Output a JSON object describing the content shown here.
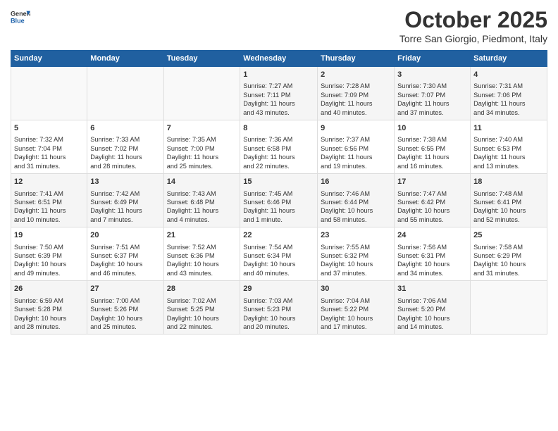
{
  "header": {
    "logo_general": "General",
    "logo_blue": "Blue",
    "title": "October 2025",
    "location": "Torre San Giorgio, Piedmont, Italy"
  },
  "days_of_week": [
    "Sunday",
    "Monday",
    "Tuesday",
    "Wednesday",
    "Thursday",
    "Friday",
    "Saturday"
  ],
  "weeks": [
    [
      {
        "day": "",
        "info": ""
      },
      {
        "day": "",
        "info": ""
      },
      {
        "day": "",
        "info": ""
      },
      {
        "day": "1",
        "info": "Sunrise: 7:27 AM\nSunset: 7:11 PM\nDaylight: 11 hours\nand 43 minutes."
      },
      {
        "day": "2",
        "info": "Sunrise: 7:28 AM\nSunset: 7:09 PM\nDaylight: 11 hours\nand 40 minutes."
      },
      {
        "day": "3",
        "info": "Sunrise: 7:30 AM\nSunset: 7:07 PM\nDaylight: 11 hours\nand 37 minutes."
      },
      {
        "day": "4",
        "info": "Sunrise: 7:31 AM\nSunset: 7:06 PM\nDaylight: 11 hours\nand 34 minutes."
      }
    ],
    [
      {
        "day": "5",
        "info": "Sunrise: 7:32 AM\nSunset: 7:04 PM\nDaylight: 11 hours\nand 31 minutes."
      },
      {
        "day": "6",
        "info": "Sunrise: 7:33 AM\nSunset: 7:02 PM\nDaylight: 11 hours\nand 28 minutes."
      },
      {
        "day": "7",
        "info": "Sunrise: 7:35 AM\nSunset: 7:00 PM\nDaylight: 11 hours\nand 25 minutes."
      },
      {
        "day": "8",
        "info": "Sunrise: 7:36 AM\nSunset: 6:58 PM\nDaylight: 11 hours\nand 22 minutes."
      },
      {
        "day": "9",
        "info": "Sunrise: 7:37 AM\nSunset: 6:56 PM\nDaylight: 11 hours\nand 19 minutes."
      },
      {
        "day": "10",
        "info": "Sunrise: 7:38 AM\nSunset: 6:55 PM\nDaylight: 11 hours\nand 16 minutes."
      },
      {
        "day": "11",
        "info": "Sunrise: 7:40 AM\nSunset: 6:53 PM\nDaylight: 11 hours\nand 13 minutes."
      }
    ],
    [
      {
        "day": "12",
        "info": "Sunrise: 7:41 AM\nSunset: 6:51 PM\nDaylight: 11 hours\nand 10 minutes."
      },
      {
        "day": "13",
        "info": "Sunrise: 7:42 AM\nSunset: 6:49 PM\nDaylight: 11 hours\nand 7 minutes."
      },
      {
        "day": "14",
        "info": "Sunrise: 7:43 AM\nSunset: 6:48 PM\nDaylight: 11 hours\nand 4 minutes."
      },
      {
        "day": "15",
        "info": "Sunrise: 7:45 AM\nSunset: 6:46 PM\nDaylight: 11 hours\nand 1 minute."
      },
      {
        "day": "16",
        "info": "Sunrise: 7:46 AM\nSunset: 6:44 PM\nDaylight: 10 hours\nand 58 minutes."
      },
      {
        "day": "17",
        "info": "Sunrise: 7:47 AM\nSunset: 6:42 PM\nDaylight: 10 hours\nand 55 minutes."
      },
      {
        "day": "18",
        "info": "Sunrise: 7:48 AM\nSunset: 6:41 PM\nDaylight: 10 hours\nand 52 minutes."
      }
    ],
    [
      {
        "day": "19",
        "info": "Sunrise: 7:50 AM\nSunset: 6:39 PM\nDaylight: 10 hours\nand 49 minutes."
      },
      {
        "day": "20",
        "info": "Sunrise: 7:51 AM\nSunset: 6:37 PM\nDaylight: 10 hours\nand 46 minutes."
      },
      {
        "day": "21",
        "info": "Sunrise: 7:52 AM\nSunset: 6:36 PM\nDaylight: 10 hours\nand 43 minutes."
      },
      {
        "day": "22",
        "info": "Sunrise: 7:54 AM\nSunset: 6:34 PM\nDaylight: 10 hours\nand 40 minutes."
      },
      {
        "day": "23",
        "info": "Sunrise: 7:55 AM\nSunset: 6:32 PM\nDaylight: 10 hours\nand 37 minutes."
      },
      {
        "day": "24",
        "info": "Sunrise: 7:56 AM\nSunset: 6:31 PM\nDaylight: 10 hours\nand 34 minutes."
      },
      {
        "day": "25",
        "info": "Sunrise: 7:58 AM\nSunset: 6:29 PM\nDaylight: 10 hours\nand 31 minutes."
      }
    ],
    [
      {
        "day": "26",
        "info": "Sunrise: 6:59 AM\nSunset: 5:28 PM\nDaylight: 10 hours\nand 28 minutes."
      },
      {
        "day": "27",
        "info": "Sunrise: 7:00 AM\nSunset: 5:26 PM\nDaylight: 10 hours\nand 25 minutes."
      },
      {
        "day": "28",
        "info": "Sunrise: 7:02 AM\nSunset: 5:25 PM\nDaylight: 10 hours\nand 22 minutes."
      },
      {
        "day": "29",
        "info": "Sunrise: 7:03 AM\nSunset: 5:23 PM\nDaylight: 10 hours\nand 20 minutes."
      },
      {
        "day": "30",
        "info": "Sunrise: 7:04 AM\nSunset: 5:22 PM\nDaylight: 10 hours\nand 17 minutes."
      },
      {
        "day": "31",
        "info": "Sunrise: 7:06 AM\nSunset: 5:20 PM\nDaylight: 10 hours\nand 14 minutes."
      },
      {
        "day": "",
        "info": ""
      }
    ]
  ]
}
